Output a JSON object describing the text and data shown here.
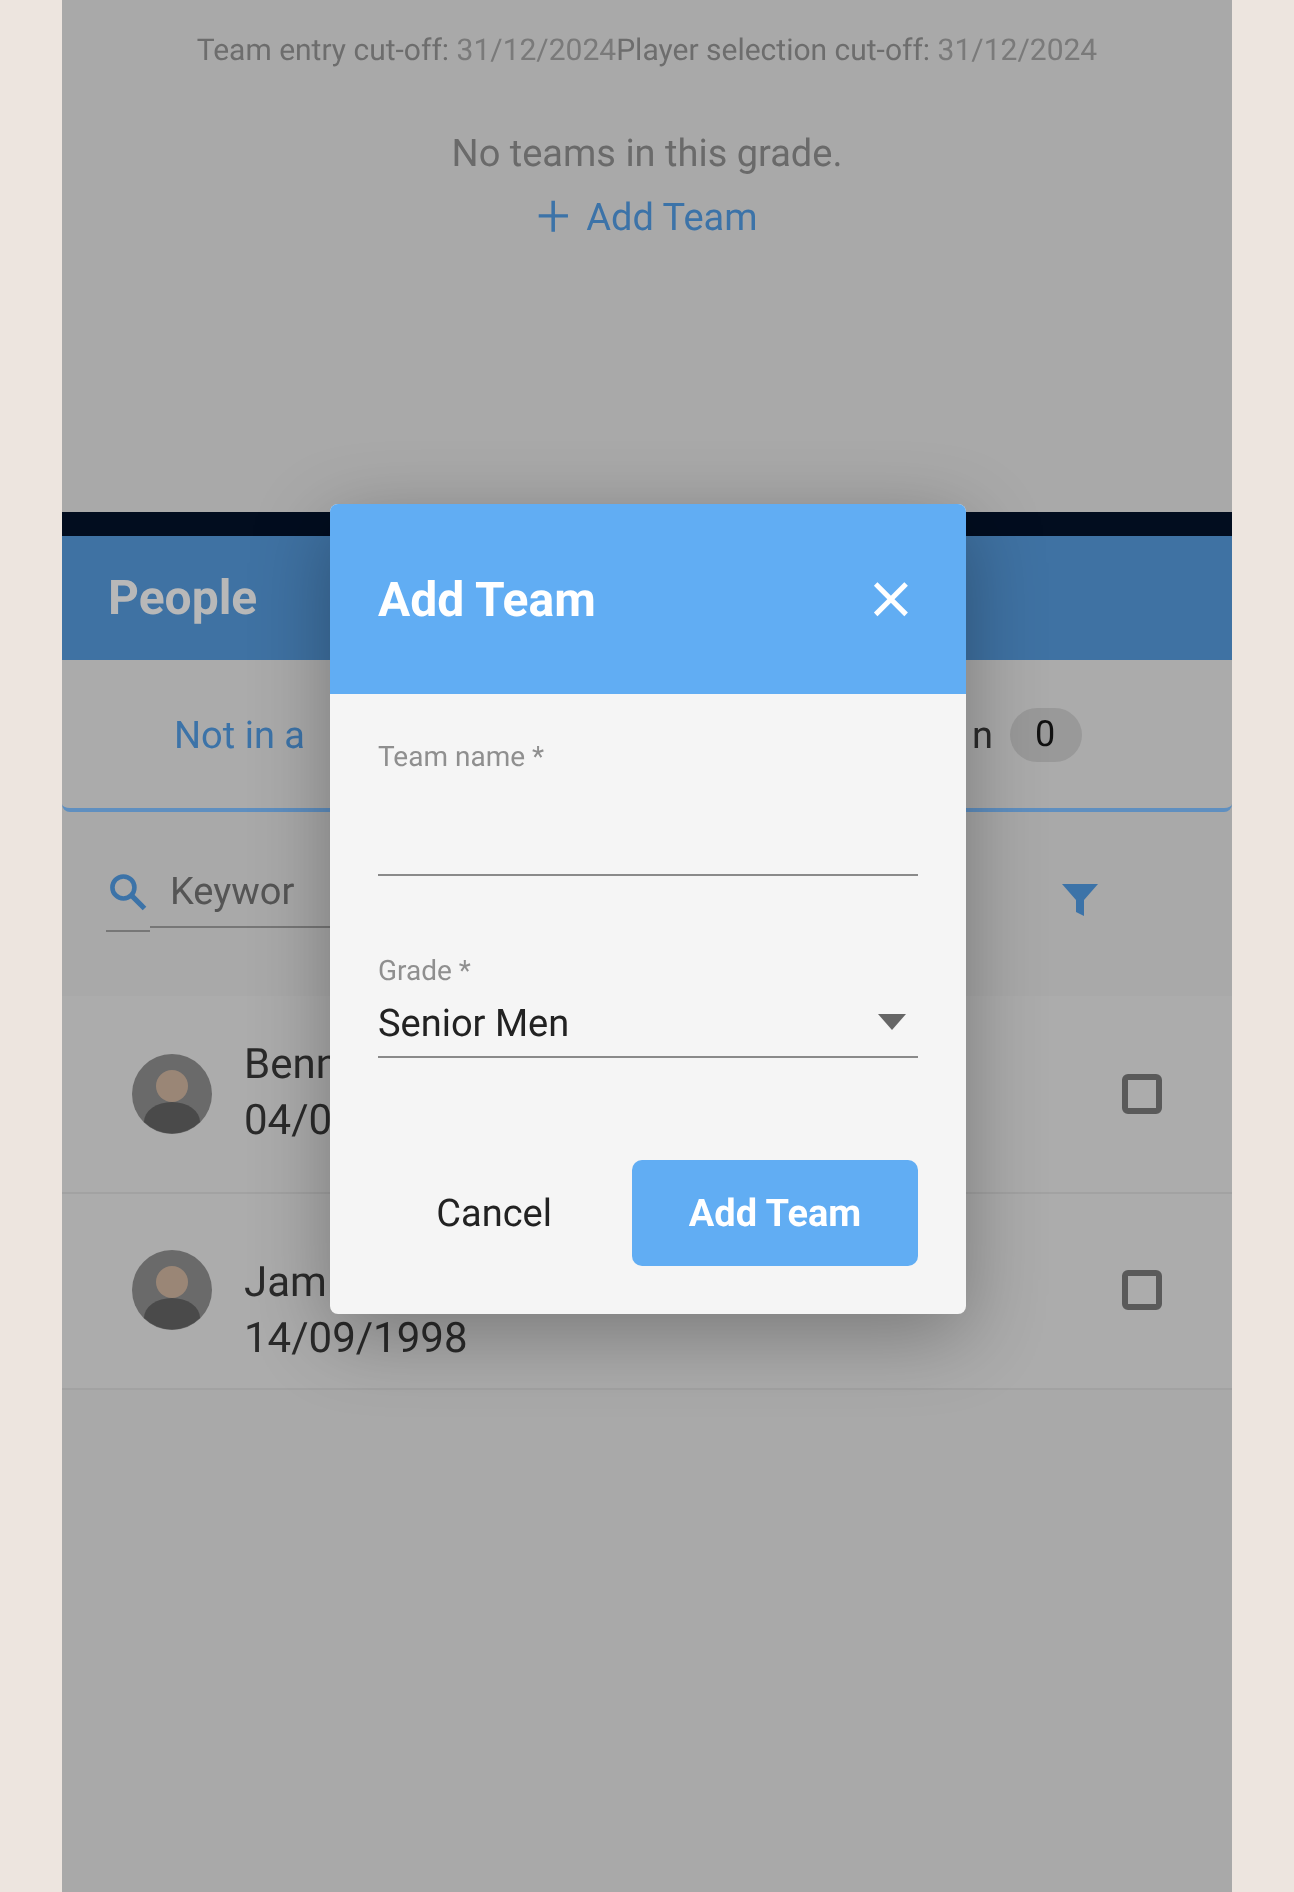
{
  "cutoffs": [
    {
      "label": "Team entry cut-off:",
      "date": "31/12/2024"
    },
    {
      "label": "Player selection cut-off:",
      "date": "31/12/2024"
    }
  ],
  "empty_message": "No teams in this grade.",
  "add_team_link": {
    "icon": "+",
    "label": "Add Team"
  },
  "people": {
    "title": "People",
    "tabs": [
      {
        "label": "Not in a",
        "selected": true
      },
      {
        "label": "n",
        "count": "0",
        "selected": false
      }
    ],
    "search": {
      "placeholder": "Keywor"
    },
    "rows": [
      {
        "name": "Benn",
        "date": "04/0",
        "checked": false
      },
      {
        "name": "Jam",
        "date": "14/09/1998",
        "checked": false
      }
    ]
  },
  "dialog": {
    "title": "Add Team",
    "close": "×",
    "fields": [
      {
        "kind": "text",
        "label": "Team name *"
      },
      {
        "kind": "select",
        "label": "Grade *",
        "value": "Senior Men"
      }
    ],
    "buttons": [
      {
        "kind": "text",
        "label": "Cancel"
      },
      {
        "kind": "primary",
        "label": "Add Team"
      }
    ]
  }
}
